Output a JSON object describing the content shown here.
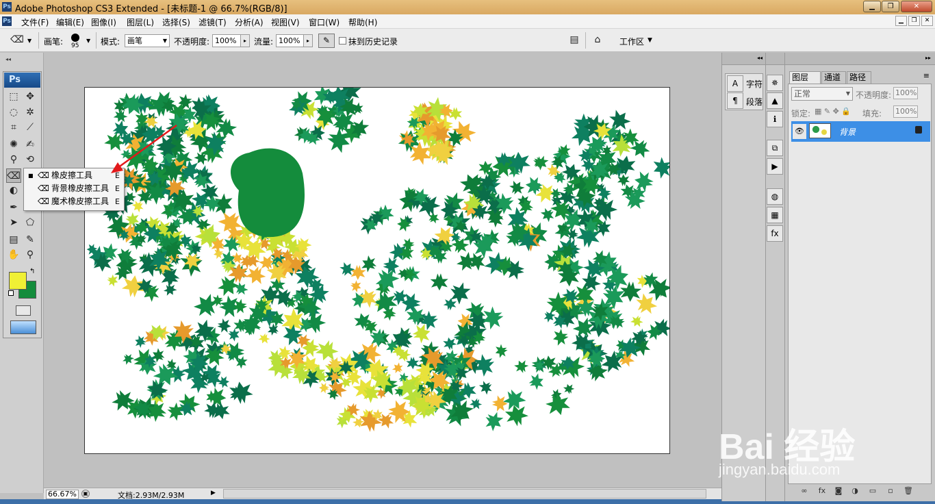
{
  "titlebar": {
    "title": "Adobe Photoshop CS3 Extended - [未标题-1 @ 66.7%(RGB/8)]",
    "controls": [
      "▁",
      "❐",
      "✕"
    ]
  },
  "menubar": {
    "app_icon": "Ps",
    "items": [
      "文件(F)",
      "编辑(E)",
      "图像(I)",
      "图层(L)",
      "选择(S)",
      "滤镜(T)",
      "分析(A)",
      "视图(V)",
      "窗口(W)",
      "帮助(H)"
    ]
  },
  "options": {
    "brush_label": "画笔:",
    "brush_size": "95",
    "mode_label": "模式:",
    "mode_value": "画笔",
    "opacity_label": "不透明度:",
    "opacity_value": "100%",
    "flow_label": "流量:",
    "flow_value": "100%",
    "history_label": "抹到历史记录",
    "workspace_label": "工作区"
  },
  "toolbox": {
    "ps_label": "Ps",
    "colors": {
      "foreground": "#f0f035",
      "background": "#148c3c"
    }
  },
  "eraser_flyout": {
    "items": [
      {
        "label": "橡皮擦工具",
        "key": "E",
        "selected": true
      },
      {
        "label": "背景橡皮擦工具",
        "key": "E",
        "selected": false
      },
      {
        "label": "魔术橡皮擦工具",
        "key": "E",
        "selected": false
      }
    ]
  },
  "status": {
    "zoom": "66.67%",
    "doc": "文档:2.93M/2.93M"
  },
  "dock_text": {
    "character": "字符",
    "paragraph": "段落"
  },
  "layers_panel": {
    "tabs": [
      "图层",
      "通道",
      "路径"
    ],
    "blend_mode": "正常",
    "opacity_label": "不透明度:",
    "opacity_value": "100%",
    "lock_label": "锁定:",
    "fill_label": "填充:",
    "fill_value": "100%",
    "layers": [
      {
        "name": "背景",
        "visible": true,
        "locked": true
      }
    ]
  },
  "watermark": {
    "main": "Bai 经验",
    "sub": "jingyan.baidu.com"
  }
}
